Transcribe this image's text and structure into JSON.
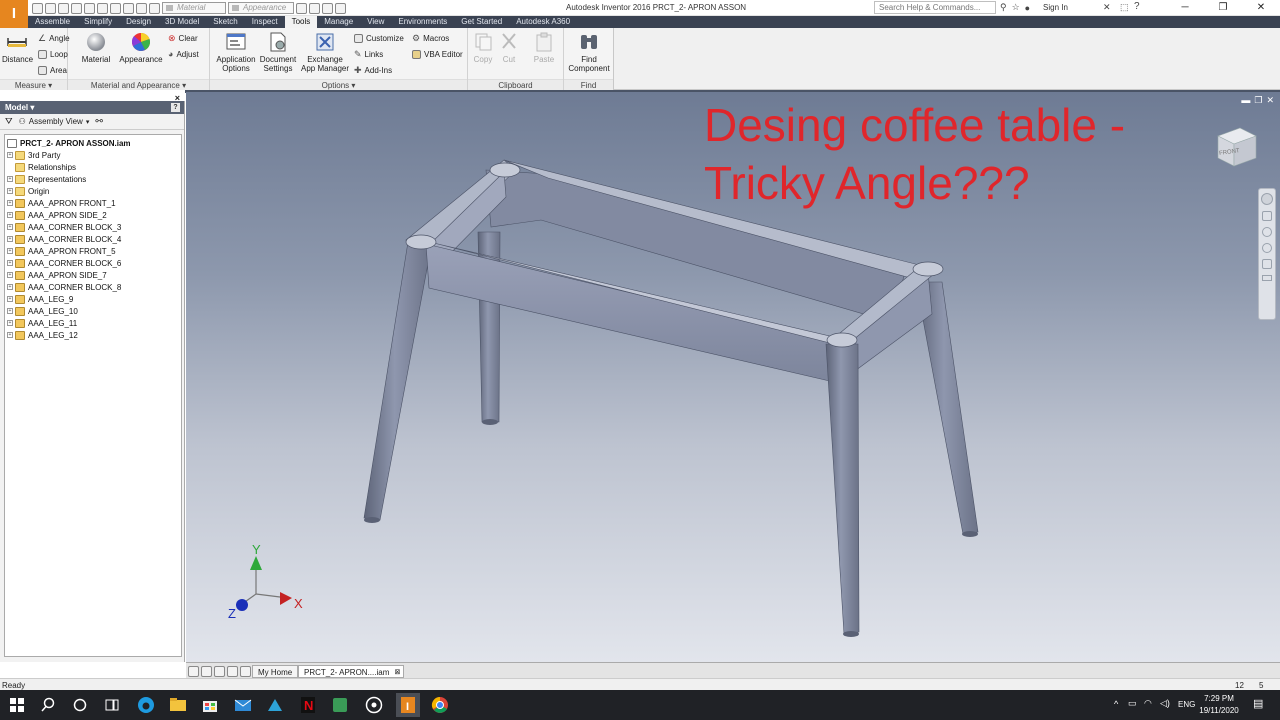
{
  "app": {
    "logo_letter": "I",
    "title": "Autodesk Inventor 2016   PRCT_2- APRON ASSON",
    "search_placeholder": "Search Help & Commands...",
    "sign_in": "Sign In",
    "qat_material": "Material",
    "qat_appearance": "Appearance"
  },
  "tabs": [
    "Assemble",
    "Simplify",
    "Design",
    "3D Model",
    "Sketch",
    "Inspect",
    "Tools",
    "Manage",
    "View",
    "Environments",
    "Get Started",
    "Autodesk A360"
  ],
  "active_tab": "Tools",
  "ribbon": {
    "measure": {
      "title": "Measure ▾",
      "distance": "Distance",
      "angle": "Angle",
      "loop": "Loop",
      "area": "Area"
    },
    "material_appearance": {
      "title": "Material and Appearance ▾",
      "material": "Material",
      "appearance": "Appearance",
      "clear": "Clear",
      "adjust": "Adjust"
    },
    "options": {
      "title": "Options ▾",
      "app_options_1": "Application",
      "app_options_2": "Options",
      "doc_settings_1": "Document",
      "doc_settings_2": "Settings",
      "exchange_1": "Exchange",
      "exchange_2": "App Manager",
      "customize": "Customize",
      "links": "Links",
      "addins": "Add-Ins",
      "macros": "Macros",
      "vba": "VBA Editor"
    },
    "clipboard": {
      "title": "Clipboard",
      "copy": "Copy",
      "cut": "Cut",
      "paste": "Paste"
    },
    "find": {
      "title": "Find",
      "find_1": "Find",
      "find_2": "Component"
    }
  },
  "browser": {
    "title": "Model ▾",
    "help": "?",
    "close": "×",
    "view_label": "Assembly View",
    "root": "PRCT_2- APRON ASSON.iam",
    "items": [
      {
        "label": "3rd Party",
        "icon": "folder",
        "expand": true
      },
      {
        "label": "Relationships",
        "icon": "folder",
        "expand": false
      },
      {
        "label": "Representations",
        "icon": "folder",
        "expand": true
      },
      {
        "label": "Origin",
        "icon": "folder",
        "expand": true
      },
      {
        "label": "AAA_APRON FRONT_1",
        "icon": "part",
        "expand": true
      },
      {
        "label": "AAA_APRON SIDE_2",
        "icon": "part",
        "expand": true
      },
      {
        "label": "AAA_CORNER BLOCK_3",
        "icon": "part",
        "expand": true
      },
      {
        "label": "AAA_CORNER BLOCK_4",
        "icon": "part",
        "expand": true
      },
      {
        "label": "AAA_APRON FRONT_5",
        "icon": "part",
        "expand": true
      },
      {
        "label": "AAA_CORNER BLOCK_6",
        "icon": "part",
        "expand": true
      },
      {
        "label": "AAA_APRON SIDE_7",
        "icon": "part",
        "expand": true
      },
      {
        "label": "AAA_CORNER BLOCK_8",
        "icon": "part",
        "expand": true
      },
      {
        "label": "AAA_LEG_9",
        "icon": "part",
        "expand": true
      },
      {
        "label": "AAA_LEG_10",
        "icon": "part",
        "expand": true
      },
      {
        "label": "AAA_LEG_11",
        "icon": "part",
        "expand": true
      },
      {
        "label": "AAA_LEG_12",
        "icon": "part",
        "expand": true
      }
    ]
  },
  "viewport": {
    "heading_line1": "Desing coffee table -",
    "heading_line2": "Tricky Angle???",
    "viewcube_label": "FRONT",
    "axis_x": "X",
    "axis_y": "Y",
    "axis_z": "Z",
    "model_color": "#8f97ae",
    "heading_color": "#e0262b"
  },
  "doc_tabs": {
    "home": "My Home",
    "doc": "PRCT_2- APRON....iam"
  },
  "status": {
    "text": "Ready",
    "n1": "12",
    "n2": "5"
  },
  "taskbar": {
    "lang": "ENG",
    "time": "7:29 PM",
    "date": "19/11/2020"
  }
}
